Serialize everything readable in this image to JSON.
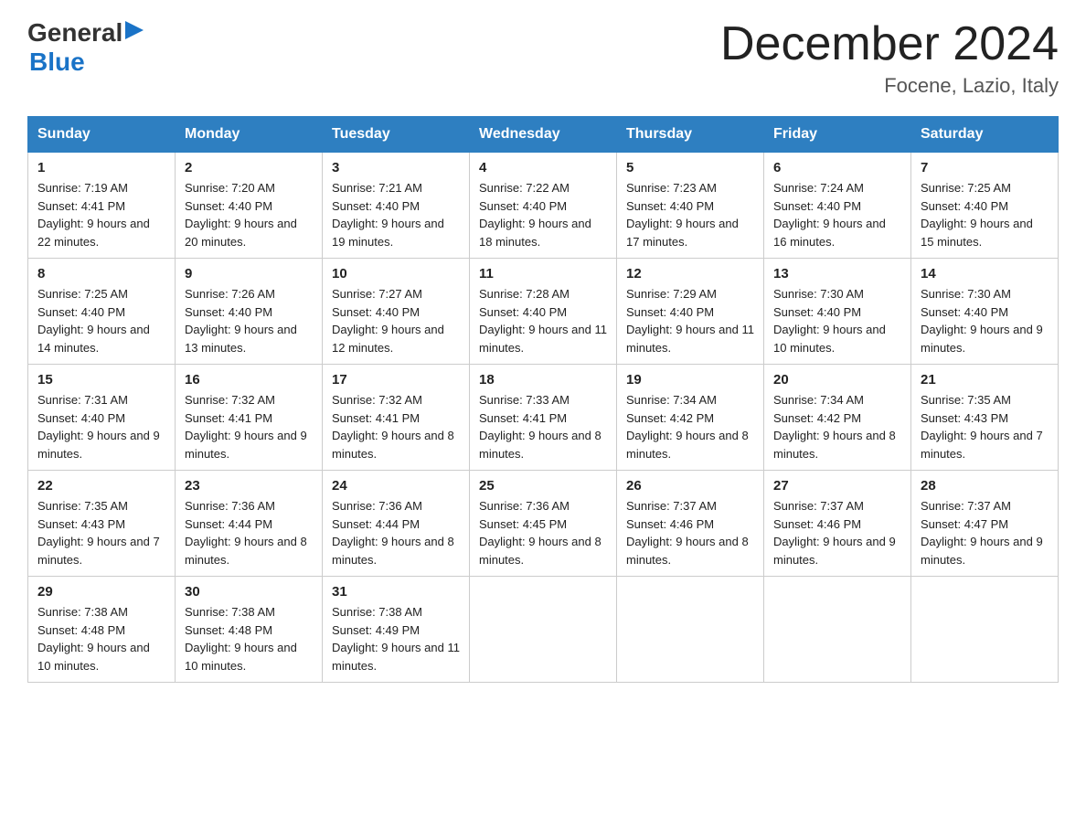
{
  "header": {
    "month_title": "December 2024",
    "location": "Focene, Lazio, Italy"
  },
  "logo": {
    "line1": "General",
    "line2": "Blue"
  },
  "days_of_week": [
    "Sunday",
    "Monday",
    "Tuesday",
    "Wednesday",
    "Thursday",
    "Friday",
    "Saturday"
  ],
  "weeks": [
    [
      {
        "day": "1",
        "sunrise": "7:19 AM",
        "sunset": "4:41 PM",
        "daylight": "9 hours and 22 minutes."
      },
      {
        "day": "2",
        "sunrise": "7:20 AM",
        "sunset": "4:40 PM",
        "daylight": "9 hours and 20 minutes."
      },
      {
        "day": "3",
        "sunrise": "7:21 AM",
        "sunset": "4:40 PM",
        "daylight": "9 hours and 19 minutes."
      },
      {
        "day": "4",
        "sunrise": "7:22 AM",
        "sunset": "4:40 PM",
        "daylight": "9 hours and 18 minutes."
      },
      {
        "day": "5",
        "sunrise": "7:23 AM",
        "sunset": "4:40 PM",
        "daylight": "9 hours and 17 minutes."
      },
      {
        "day": "6",
        "sunrise": "7:24 AM",
        "sunset": "4:40 PM",
        "daylight": "9 hours and 16 minutes."
      },
      {
        "day": "7",
        "sunrise": "7:25 AM",
        "sunset": "4:40 PM",
        "daylight": "9 hours and 15 minutes."
      }
    ],
    [
      {
        "day": "8",
        "sunrise": "7:25 AM",
        "sunset": "4:40 PM",
        "daylight": "9 hours and 14 minutes."
      },
      {
        "day": "9",
        "sunrise": "7:26 AM",
        "sunset": "4:40 PM",
        "daylight": "9 hours and 13 minutes."
      },
      {
        "day": "10",
        "sunrise": "7:27 AM",
        "sunset": "4:40 PM",
        "daylight": "9 hours and 12 minutes."
      },
      {
        "day": "11",
        "sunrise": "7:28 AM",
        "sunset": "4:40 PM",
        "daylight": "9 hours and 11 minutes."
      },
      {
        "day": "12",
        "sunrise": "7:29 AM",
        "sunset": "4:40 PM",
        "daylight": "9 hours and 11 minutes."
      },
      {
        "day": "13",
        "sunrise": "7:30 AM",
        "sunset": "4:40 PM",
        "daylight": "9 hours and 10 minutes."
      },
      {
        "day": "14",
        "sunrise": "7:30 AM",
        "sunset": "4:40 PM",
        "daylight": "9 hours and 9 minutes."
      }
    ],
    [
      {
        "day": "15",
        "sunrise": "7:31 AM",
        "sunset": "4:40 PM",
        "daylight": "9 hours and 9 minutes."
      },
      {
        "day": "16",
        "sunrise": "7:32 AM",
        "sunset": "4:41 PM",
        "daylight": "9 hours and 9 minutes."
      },
      {
        "day": "17",
        "sunrise": "7:32 AM",
        "sunset": "4:41 PM",
        "daylight": "9 hours and 8 minutes."
      },
      {
        "day": "18",
        "sunrise": "7:33 AM",
        "sunset": "4:41 PM",
        "daylight": "9 hours and 8 minutes."
      },
      {
        "day": "19",
        "sunrise": "7:34 AM",
        "sunset": "4:42 PM",
        "daylight": "9 hours and 8 minutes."
      },
      {
        "day": "20",
        "sunrise": "7:34 AM",
        "sunset": "4:42 PM",
        "daylight": "9 hours and 8 minutes."
      },
      {
        "day": "21",
        "sunrise": "7:35 AM",
        "sunset": "4:43 PM",
        "daylight": "9 hours and 7 minutes."
      }
    ],
    [
      {
        "day": "22",
        "sunrise": "7:35 AM",
        "sunset": "4:43 PM",
        "daylight": "9 hours and 7 minutes."
      },
      {
        "day": "23",
        "sunrise": "7:36 AM",
        "sunset": "4:44 PM",
        "daylight": "9 hours and 8 minutes."
      },
      {
        "day": "24",
        "sunrise": "7:36 AM",
        "sunset": "4:44 PM",
        "daylight": "9 hours and 8 minutes."
      },
      {
        "day": "25",
        "sunrise": "7:36 AM",
        "sunset": "4:45 PM",
        "daylight": "9 hours and 8 minutes."
      },
      {
        "day": "26",
        "sunrise": "7:37 AM",
        "sunset": "4:46 PM",
        "daylight": "9 hours and 8 minutes."
      },
      {
        "day": "27",
        "sunrise": "7:37 AM",
        "sunset": "4:46 PM",
        "daylight": "9 hours and 9 minutes."
      },
      {
        "day": "28",
        "sunrise": "7:37 AM",
        "sunset": "4:47 PM",
        "daylight": "9 hours and 9 minutes."
      }
    ],
    [
      {
        "day": "29",
        "sunrise": "7:38 AM",
        "sunset": "4:48 PM",
        "daylight": "9 hours and 10 minutes."
      },
      {
        "day": "30",
        "sunrise": "7:38 AM",
        "sunset": "4:48 PM",
        "daylight": "9 hours and 10 minutes."
      },
      {
        "day": "31",
        "sunrise": "7:38 AM",
        "sunset": "4:49 PM",
        "daylight": "9 hours and 11 minutes."
      },
      null,
      null,
      null,
      null
    ]
  ]
}
